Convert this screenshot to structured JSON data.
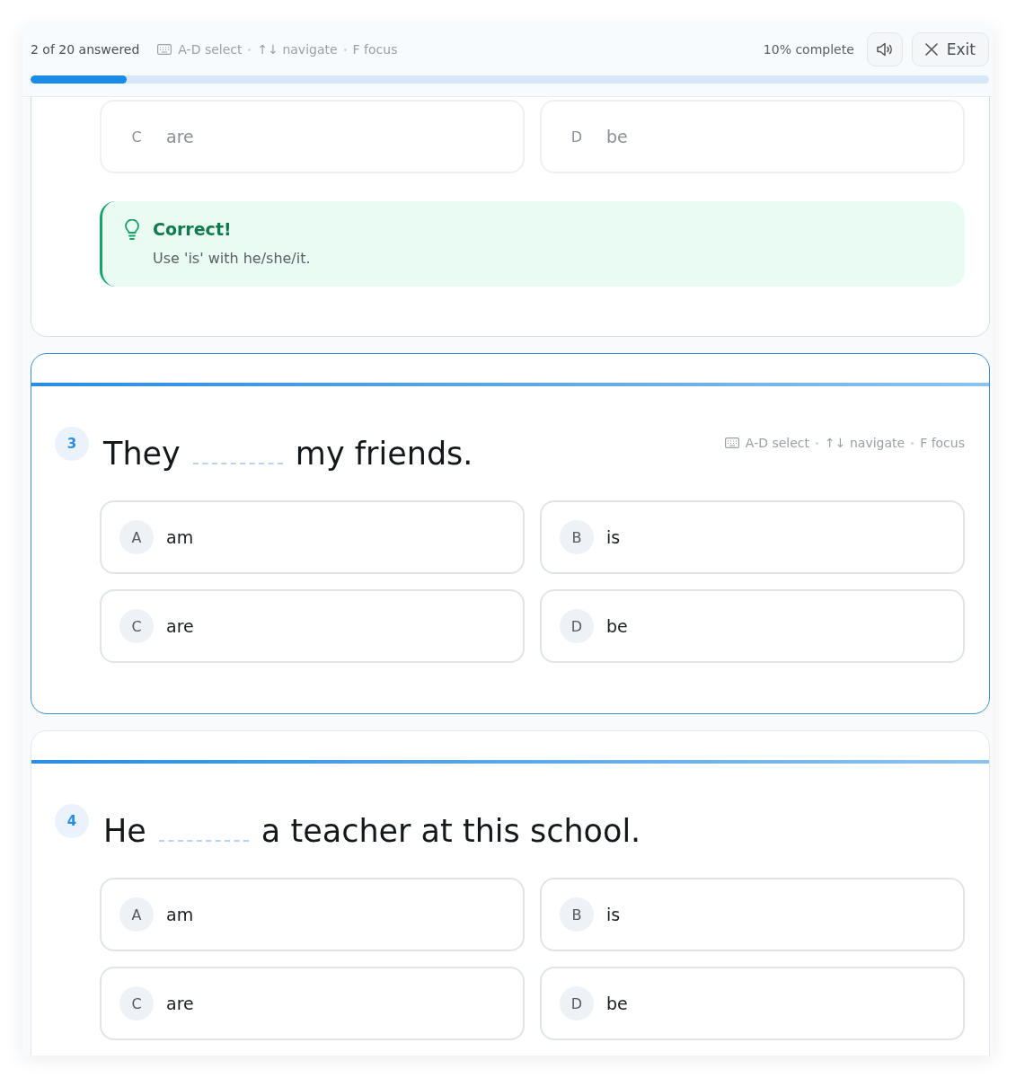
{
  "header": {
    "answered": "2 of 20 answered",
    "hints": [
      "A-D select",
      "↑↓ navigate",
      "F focus"
    ],
    "complete": "10% complete",
    "level": 0.1,
    "exit": "Exit"
  },
  "previous_card": {
    "options": [
      {
        "letter": "C",
        "text": "are",
        "disabled": true
      },
      {
        "letter": "D",
        "text": "be",
        "disabled": true
      }
    ],
    "feedback": {
      "title": "Correct!",
      "text": "Use 'is' with he/she/it."
    }
  },
  "questions": [
    {
      "number": "3",
      "before": "They",
      "after": "my friends.",
      "active": true,
      "hints": [
        "A-D select",
        "↑↓ navigate",
        "F focus"
      ],
      "options": [
        {
          "letter": "A",
          "text": "am",
          "disabled": false
        },
        {
          "letter": "B",
          "text": "is",
          "disabled": false
        },
        {
          "letter": "C",
          "text": "are",
          "disabled": false
        },
        {
          "letter": "D",
          "text": "be",
          "disabled": false
        }
      ]
    },
    {
      "number": "4",
      "before": "He",
      "after": "a teacher at this school.",
      "active": false,
      "options": [
        {
          "letter": "A",
          "text": "am",
          "disabled": false
        },
        {
          "letter": "B",
          "text": "is",
          "disabled": false
        },
        {
          "letter": "C",
          "text": "are",
          "disabled": false
        },
        {
          "letter": "D",
          "text": "be",
          "disabled": false
        }
      ]
    }
  ]
}
